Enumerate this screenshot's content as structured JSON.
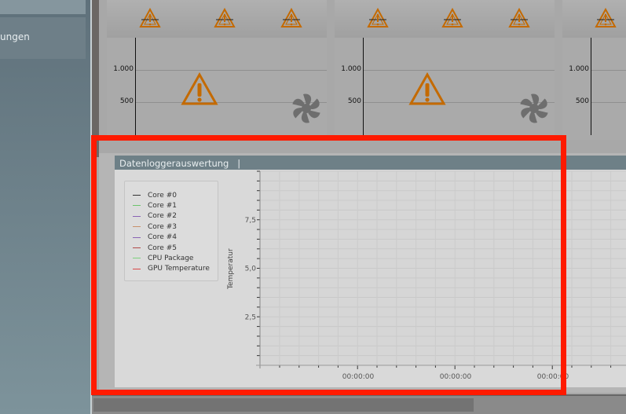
{
  "sidebar": {
    "item_label": "ungen"
  },
  "panels": [
    {
      "ticks": [
        "1.000",
        "500"
      ]
    },
    {
      "ticks": [
        "1.000",
        "500"
      ]
    },
    {
      "ticks": [
        "1.000",
        "500"
      ]
    }
  ],
  "datalogger": {
    "title": "Datenloggerauswertung   |",
    "legend": [
      {
        "label": "Core #0",
        "color": "#333333"
      },
      {
        "label": "Core #1",
        "color": "#6cc46c"
      },
      {
        "label": "Core #2",
        "color": "#8a64b4"
      },
      {
        "label": "Core #3",
        "color": "#c8906a"
      },
      {
        "label": "Core #4",
        "color": "#8a64b4"
      },
      {
        "label": "Core #5",
        "color": "#b04a4a"
      },
      {
        "label": "CPU Package",
        "color": "#7cd07c"
      },
      {
        "label": "GPU Temperature",
        "color": "#d84848"
      }
    ]
  },
  "chart_data": {
    "type": "line",
    "ylabel": "Temperatur",
    "xlabel": "",
    "ylim": [
      0,
      10
    ],
    "yticks": [
      "2,5",
      "5,0",
      "7,5"
    ],
    "ytick_values": [
      2.5,
      5.0,
      7.5
    ],
    "xticks": [
      "00:00:00",
      "00:00:00",
      "00:00:00"
    ],
    "series": [],
    "grid": true
  },
  "colors": {
    "highlight": "#ff1a00",
    "warning": "#c46a00"
  }
}
